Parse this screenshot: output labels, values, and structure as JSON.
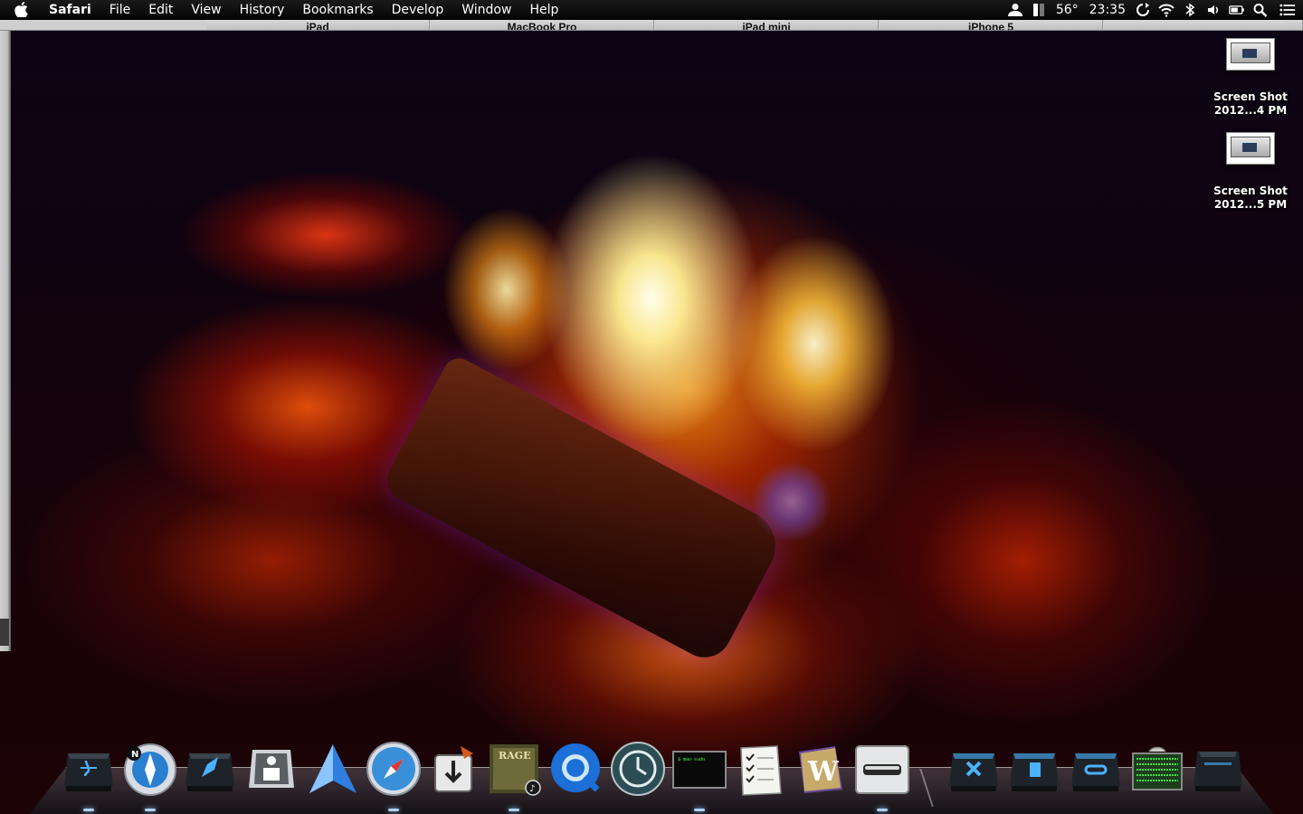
{
  "menubar": {
    "apple_icon": "apple-icon",
    "app_name": "Safari",
    "items": [
      "File",
      "Edit",
      "View",
      "History",
      "Bookmarks",
      "Develop",
      "Window",
      "Help"
    ],
    "status": {
      "temperature": "56°",
      "clock": "23:35",
      "icons": [
        "user-icon",
        "battery-bars-icon",
        "sync-icon",
        "wifi-icon",
        "bluetooth-icon",
        "volume-icon",
        "battery-icon",
        "spotlight-icon",
        "notification-center-icon"
      ]
    }
  },
  "safari_tabs": [
    "iPad",
    "MacBook Pro",
    "iPad mini",
    "iPhone 5",
    ""
  ],
  "desktop_files": [
    {
      "name": "Screen Shot",
      "detail": "2012...4 PM"
    },
    {
      "name": "Screen Shot",
      "detail": "2012...5 PM"
    }
  ],
  "dock": {
    "apps": [
      {
        "name": "Finder",
        "icon": "finder-icon",
        "running": true
      },
      {
        "name": "Compass",
        "icon": "compass-icon",
        "running": true
      },
      {
        "name": "Launchpad",
        "icon": "launchpad-icon",
        "running": false
      },
      {
        "name": "App Store",
        "icon": "app-store-icon",
        "running": false
      },
      {
        "name": "Sparrow",
        "icon": "sparrow-icon",
        "running": false
      },
      {
        "name": "Safari",
        "icon": "safari-icon",
        "running": true
      },
      {
        "name": "Transmit",
        "icon": "transmit-icon",
        "running": false
      },
      {
        "name": "iTunes",
        "icon": "itunes-album-icon",
        "running": true
      },
      {
        "name": "QuickTime Player",
        "icon": "quicktime-icon",
        "running": false
      },
      {
        "name": "Time Machine",
        "icon": "time-machine-icon",
        "running": false
      },
      {
        "name": "Terminal",
        "icon": "terminal-icon",
        "running": true
      },
      {
        "name": "Reminders",
        "icon": "reminders-icon",
        "running": false
      },
      {
        "name": "Wunderlist",
        "icon": "wunderlist-icon",
        "running": false
      },
      {
        "name": "Flashcard",
        "icon": "flashcard-icon",
        "running": true
      }
    ],
    "right_items": [
      {
        "name": "Applications",
        "icon": "applications-stack-icon"
      },
      {
        "name": "Documents",
        "icon": "documents-stack-icon"
      },
      {
        "name": "Utilities",
        "icon": "utilities-stack-icon"
      },
      {
        "name": "Activity Monitor",
        "icon": "activity-monitor-icon"
      },
      {
        "name": "Trash",
        "icon": "trash-icon"
      }
    ],
    "terminal_text": "$ man sudo"
  }
}
